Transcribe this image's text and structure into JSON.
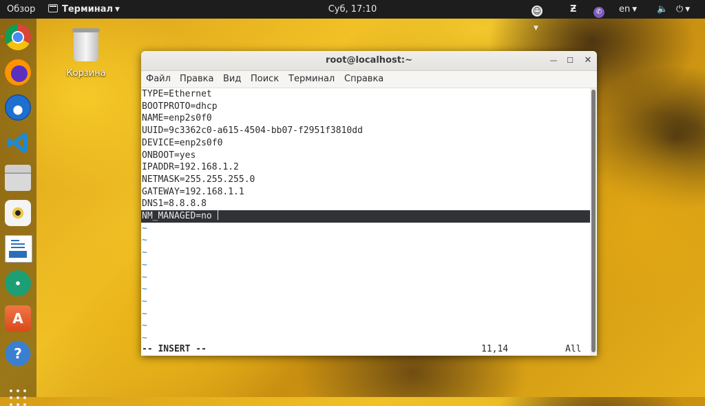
{
  "topbar": {
    "activities": "Обзор",
    "app_menu": "Терминал",
    "clock": "Суб, 17:10",
    "accessibility_icon": "accessibility-icon",
    "input_lang": "en",
    "volume_icon": "volume-icon",
    "power_icon": "power-icon"
  },
  "dock": {
    "items": [
      "chrome-icon",
      "firefox-icon",
      "thunderbird-icon",
      "vscode-icon",
      "files-icon",
      "rhythmbox-icon",
      "writer-icon",
      "atom-icon",
      "software-center-icon",
      "help-icon"
    ],
    "apps_grid_icon": "apps-grid-icon"
  },
  "desktop": {
    "trash_label": "Корзина"
  },
  "window": {
    "title": "root@localhost:~",
    "menu": [
      "Файл",
      "Правка",
      "Вид",
      "Поиск",
      "Терминал",
      "Справка"
    ],
    "lines": [
      "TYPE=Ethernet",
      "BOOTPROTO=dhcp",
      "NAME=enp2s0f0",
      "UUID=9c3362c0-a615-4504-bb07-f2951f3810dd",
      "DEVICE=enp2s0f0",
      "ONBOOT=yes",
      "IPADDR=192.168.1.2",
      "NETMASK=255.255.255.0",
      "GATEWAY=192.168.1.1",
      "DNS1=8.8.8.8",
      "NM_MANAGED=no"
    ],
    "tilde": "~",
    "status": {
      "mode": "-- INSERT --",
      "position": "11,14",
      "scroll": "All"
    }
  }
}
